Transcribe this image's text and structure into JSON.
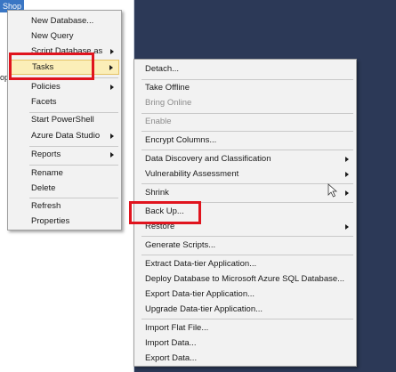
{
  "object_explorer": {
    "selected_node_fragment": "Shop",
    "tree_fragment": "op"
  },
  "context_menu": {
    "items": [
      {
        "label": "New Database...",
        "has_submenu": false
      },
      {
        "label": "New Query",
        "has_submenu": false
      },
      {
        "label": "Script Database as",
        "has_submenu": true
      },
      {
        "label": "Tasks",
        "has_submenu": true,
        "hovered": true
      },
      {
        "label": "Policies",
        "has_submenu": true
      },
      {
        "label": "Facets",
        "has_submenu": false
      },
      {
        "label": "Start PowerShell",
        "has_submenu": false
      },
      {
        "label": "Azure Data Studio",
        "has_submenu": true
      },
      {
        "label": "Reports",
        "has_submenu": true
      },
      {
        "label": "Rename",
        "has_submenu": false
      },
      {
        "label": "Delete",
        "has_submenu": false
      },
      {
        "label": "Refresh",
        "has_submenu": false
      },
      {
        "label": "Properties",
        "has_submenu": false
      }
    ]
  },
  "tasks_submenu": {
    "items": [
      {
        "label": "Detach...",
        "has_submenu": false
      },
      {
        "label": "Take Offline",
        "has_submenu": false
      },
      {
        "label": "Bring Online",
        "has_submenu": false,
        "disabled": true
      },
      {
        "label": "Enable",
        "has_submenu": false,
        "disabled": true
      },
      {
        "label": "Encrypt Columns...",
        "has_submenu": false
      },
      {
        "label": "Data Discovery and Classification",
        "has_submenu": true
      },
      {
        "label": "Vulnerability Assessment",
        "has_submenu": true
      },
      {
        "label": "Shrink",
        "has_submenu": true
      },
      {
        "label": "Back Up...",
        "has_submenu": false
      },
      {
        "label": "Restore",
        "has_submenu": true
      },
      {
        "label": "Generate Scripts...",
        "has_submenu": false
      },
      {
        "label": "Extract Data-tier Application...",
        "has_submenu": false
      },
      {
        "label": "Deploy Database to Microsoft Azure SQL Database...",
        "has_submenu": false
      },
      {
        "label": "Export Data-tier Application...",
        "has_submenu": false
      },
      {
        "label": "Upgrade Data-tier Application...",
        "has_submenu": false
      },
      {
        "label": "Import Flat File...",
        "has_submenu": false
      },
      {
        "label": "Import Data...",
        "has_submenu": false
      },
      {
        "label": "Export Data...",
        "has_submenu": false
      }
    ]
  },
  "colors": {
    "highlight_box": "#e0141e",
    "hover_fill": "#fbeeb8",
    "background": "#2c3957",
    "selection": "#3a76c4"
  }
}
